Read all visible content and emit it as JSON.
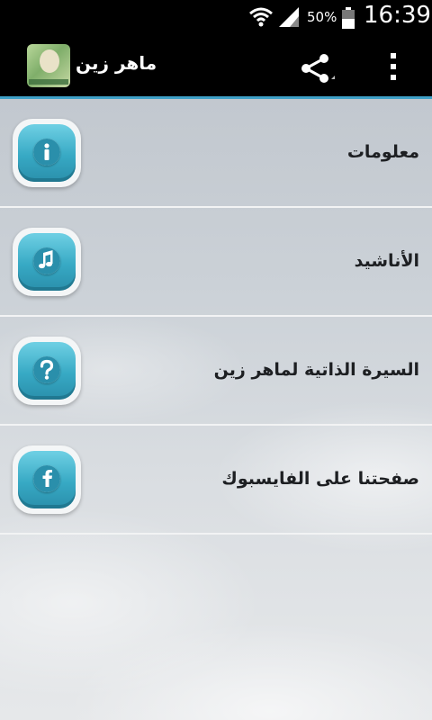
{
  "status_bar": {
    "battery_percent": "50%",
    "time": "16:39",
    "icons": [
      "wifi-icon",
      "signal-icon",
      "battery-icon"
    ]
  },
  "action_bar": {
    "title": "ماهر زين",
    "icons": [
      "app-icon",
      "share-icon",
      "overflow-menu-icon"
    ]
  },
  "menu": {
    "items": [
      {
        "label": "معلومات",
        "icon": "info-icon"
      },
      {
        "label": "الأناشيد",
        "icon": "music-note-icon"
      },
      {
        "label": "السيرة الذاتية لماهر زين",
        "icon": "question-icon"
      },
      {
        "label": "صفحتنا على الفايسبوك",
        "icon": "facebook-icon"
      }
    ]
  },
  "colors": {
    "accent": "#3ea0c8",
    "icon_button": "#37a9c4",
    "text": "#1d1f22"
  }
}
